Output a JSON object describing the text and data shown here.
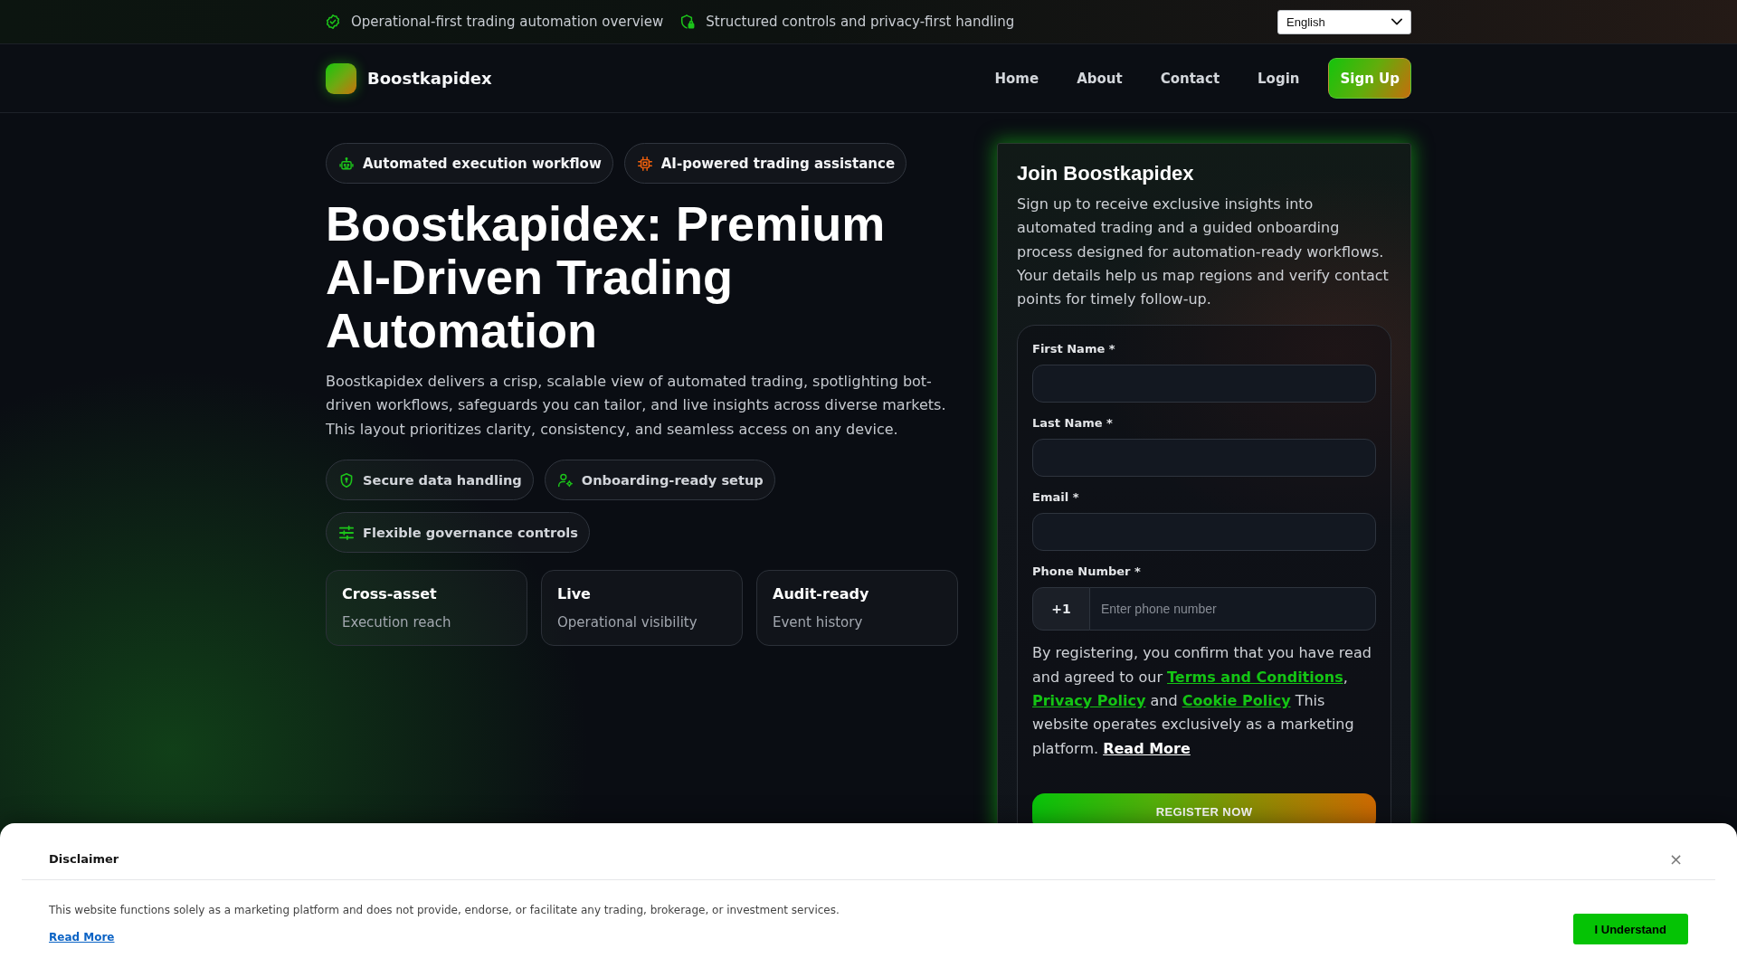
{
  "top_bar": {
    "notes": [
      "Operational-first trading automation overview",
      "Structured controls and privacy-first handling"
    ],
    "language": "English"
  },
  "nav": {
    "brand": "Boostkapidex",
    "links": [
      "Home",
      "About",
      "Contact",
      "Login"
    ],
    "cta": "Sign Up"
  },
  "hero": {
    "badges": [
      "Automated execution workflow",
      "AI-powered trading assistance"
    ],
    "title": "Boostkapidex: Premium AI-Driven Trading Automation",
    "description": "Boostkapidex delivers a crisp, scalable view of automated trading, spotlighting bot-driven workflows, safeguards you can tailor, and live insights across diverse markets. This layout prioritizes clarity, consistency, and seamless access on any device.",
    "features": [
      "Secure data handling",
      "Onboarding-ready setup",
      "Flexible governance controls"
    ],
    "stats": [
      {
        "title": "Cross-asset",
        "subtitle": "Execution reach"
      },
      {
        "title": "Live",
        "subtitle": "Operational visibility"
      },
      {
        "title": "Audit-ready",
        "subtitle": "Event history"
      }
    ]
  },
  "signup": {
    "title": "Join Boostkapidex",
    "description": "Sign up to receive exclusive insights into automated trading and a guided onboarding process designed for automation-ready workflows. Your details help us map regions and verify contact points for timely follow-up.",
    "fields": [
      {
        "label": "First Name *"
      },
      {
        "label": "Last Name *"
      },
      {
        "label": "Email *"
      }
    ],
    "phone": {
      "label": "Phone Number *",
      "prefix": "+1",
      "placeholder": "Enter phone number"
    },
    "consent": [
      {
        "kind": "text",
        "text": "By registering, you confirm that you have read and agreed to our "
      },
      {
        "kind": "link",
        "text": "Terms and Conditions"
      },
      {
        "kind": "text",
        "text": ", "
      },
      {
        "kind": "link",
        "text": "Privacy Policy"
      },
      {
        "kind": "text",
        "text": " and "
      },
      {
        "kind": "link",
        "text": "Cookie Policy"
      },
      {
        "kind": "text",
        "text": " This website operates exclusively as a marketing platform. "
      },
      {
        "kind": "more",
        "text": "Read More"
      }
    ],
    "button": "REGISTER NOW"
  },
  "disclaimer": {
    "title": "Disclaimer",
    "close": "×",
    "text": "This website functions solely as a marketing platform and does not provide, endorse, or facilitate any trading, brokerage, or investment services.",
    "link": "Read More",
    "button": "I Understand"
  }
}
